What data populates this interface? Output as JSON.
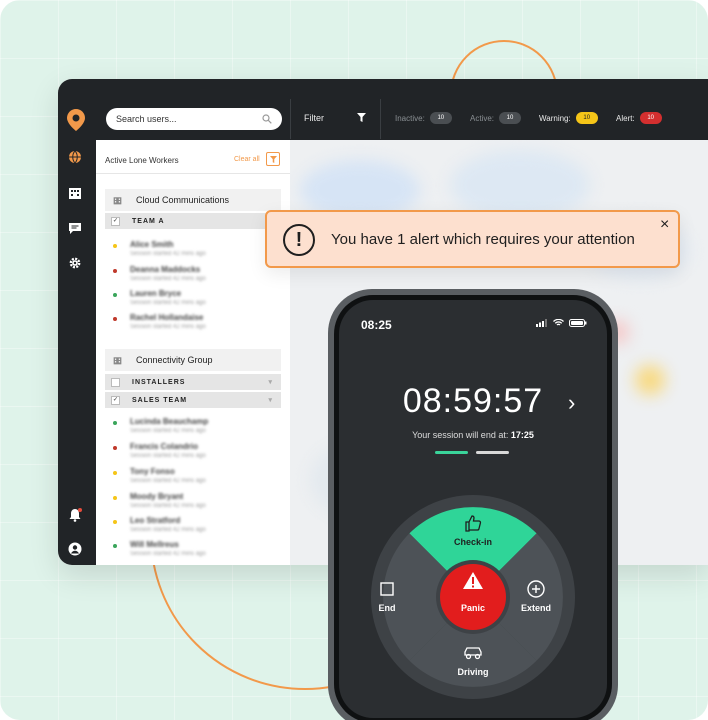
{
  "dashboard": {
    "search": {
      "placeholder": "Search users..."
    },
    "filter_label": "Filter",
    "stats": [
      {
        "label": "Inactive:",
        "count": "10",
        "color": "#4a4e52"
      },
      {
        "label": "Active:",
        "count": "10",
        "color": "#4a4e52"
      },
      {
        "label": "Warning:",
        "count": "10",
        "color": "#f5c518"
      },
      {
        "label": "Alert:",
        "count": "10",
        "color": "#d32f2f"
      }
    ],
    "sidebar_icons": [
      "globe-icon",
      "building-icon",
      "chat-icon",
      "gear-icon",
      "bell-icon",
      "user-icon"
    ],
    "panel": {
      "title": "Active Lone Workers",
      "clear_all": "Clear all",
      "groups": [
        {
          "name": "Cloud Communications",
          "teams": [
            {
              "name": "TEAM A",
              "checked": true,
              "workers": [
                {
                  "name": "Alice Smith",
                  "sub": "Session started 42 mins ago",
                  "status": "#f5c518"
                },
                {
                  "name": "Deanna Maddocks",
                  "sub": "Session started 42 mins ago",
                  "status": "#c0392b"
                },
                {
                  "name": "Lauren Bryce",
                  "sub": "Session started 42 mins ago",
                  "status": "#3aa55b"
                },
                {
                  "name": "Rachel Hollandaise",
                  "sub": "Session started 42 mins ago",
                  "status": "#c0392b"
                }
              ]
            }
          ]
        },
        {
          "name": "Connectivity Group",
          "teams": [
            {
              "name": "INSTALLERS",
              "checked": false,
              "workers": []
            },
            {
              "name": "SALES TEAM",
              "checked": true,
              "workers": [
                {
                  "name": "Lucinda Beauchamp",
                  "sub": "Session started 42 mins ago",
                  "status": "#3aa55b"
                },
                {
                  "name": "Francis Colandrio",
                  "sub": "Session started 42 mins ago",
                  "status": "#c0392b"
                },
                {
                  "name": "Tony Fonso",
                  "sub": "Session started 42 mins ago",
                  "status": "#f5c518"
                },
                {
                  "name": "Moody Bryant",
                  "sub": "Session started 42 mins ago",
                  "status": "#f5c518"
                },
                {
                  "name": "Leo Stratford",
                  "sub": "Session started 42 mins ago",
                  "status": "#f5c518"
                },
                {
                  "name": "Will Mellreus",
                  "sub": "Session started 42 mins ago",
                  "status": "#3aa55b"
                }
              ]
            }
          ]
        }
      ]
    }
  },
  "alert": {
    "message": "You have 1 alert which requires your attention",
    "close": "×"
  },
  "phone": {
    "clock": "08:25",
    "timer": "08:59:57",
    "session_prefix": "Your session will end at: ",
    "session_end": "17:25",
    "actions": {
      "checkin": "Check-in",
      "end": "End",
      "panic": "Panic",
      "extend": "Extend",
      "driving": "Driving"
    }
  },
  "colors": {
    "accent": "#f2994a",
    "checkin": "#2fd598",
    "panic": "#e21d1d",
    "dark": "#212427"
  }
}
